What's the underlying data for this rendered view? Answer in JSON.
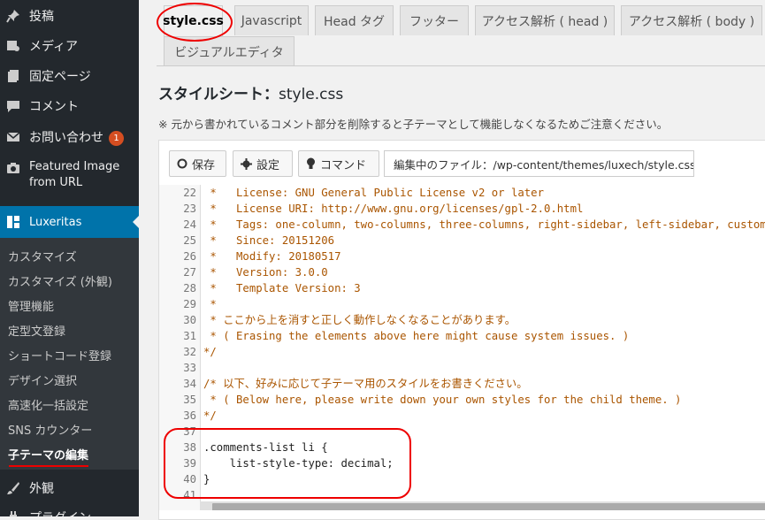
{
  "sidebar": {
    "items": [
      {
        "label": "投稿",
        "icon": "pin-icon"
      },
      {
        "label": "メディア",
        "icon": "media-icon"
      },
      {
        "label": "固定ページ",
        "icon": "page-icon"
      },
      {
        "label": "コメント",
        "icon": "comment-icon"
      },
      {
        "label": "お問い合わせ",
        "icon": "mail-icon",
        "badge": "1"
      },
      {
        "label": "Featured Image from URL",
        "icon": "camera-icon"
      },
      {
        "label": "Luxeritas",
        "icon": "grid-icon"
      }
    ],
    "submenu": [
      "カスタマイズ",
      "カスタマイズ (外観)",
      "管理機能",
      "定型文登録",
      "ショートコード登録",
      "デザイン選択",
      "高速化一括設定",
      "SNS カウンター",
      "子テーマの編集"
    ],
    "bottom": [
      {
        "label": "外観",
        "icon": "brush-icon"
      },
      {
        "label": "プラグイン",
        "icon": "plugin-icon"
      }
    ]
  },
  "tabs": [
    "style.css",
    "Javascript",
    "Head タグ",
    "フッター",
    "アクセス解析 ( head )",
    "アクセス解析 ( body )",
    "ビジュアルエディタ"
  ],
  "page": {
    "title_prefix": "スタイルシート：",
    "title_file": "style.css",
    "notice": "※ 元から書かれているコメント部分を削除すると子テーマとして機能しなくなるためご注意ください。"
  },
  "toolbar": {
    "save_label": "保存",
    "settings_label": "設定",
    "command_label": "コマンド",
    "file_label": "編集中のファイル：/wp-content/themes/luxech/style.css"
  },
  "code": {
    "lines": [
      {
        "n": "22",
        "t": " *   License: GNU General Public License v2 or later"
      },
      {
        "n": "23",
        "t": " *   License URI: http://www.gnu.org/licenses/gpl-2.0.html"
      },
      {
        "n": "24",
        "t": " *   Tags: one-column, two-columns, three-columns, right-sidebar, left-sidebar, custom-head"
      },
      {
        "n": "25",
        "t": " *   Since: 20151206"
      },
      {
        "n": "26",
        "t": " *   Modify: 20180517"
      },
      {
        "n": "27",
        "t": " *   Version: 3.0.0"
      },
      {
        "n": "28",
        "t": " *   Template Version: 3"
      },
      {
        "n": "29",
        "t": " *"
      },
      {
        "n": "30",
        "t": " * ここから上を消すと正しく動作しなくなることがあります。"
      },
      {
        "n": "31",
        "t": " * ( Erasing the elements above here might cause system issues. )"
      },
      {
        "n": "32",
        "t": "*/"
      },
      {
        "n": "33",
        "t": ""
      },
      {
        "n": "34",
        "t": "/* 以下、好みに応じて子テーマ用のスタイルをお書きください。"
      },
      {
        "n": "35",
        "t": " * ( Below here, please write down your own styles for the child theme. )"
      },
      {
        "n": "36",
        "t": "*/"
      },
      {
        "n": "37",
        "t": ""
      },
      {
        "n": "38",
        "t": ".comments-list li {",
        "code": true
      },
      {
        "n": "39",
        "t": "    list-style-type: decimal;",
        "code": true
      },
      {
        "n": "40",
        "t": "}",
        "code": true
      },
      {
        "n": "41",
        "t": ""
      }
    ]
  },
  "colors": {
    "sidebar_bg": "#23282d",
    "active_bg": "#0073aa",
    "annotation": "#e00000"
  }
}
